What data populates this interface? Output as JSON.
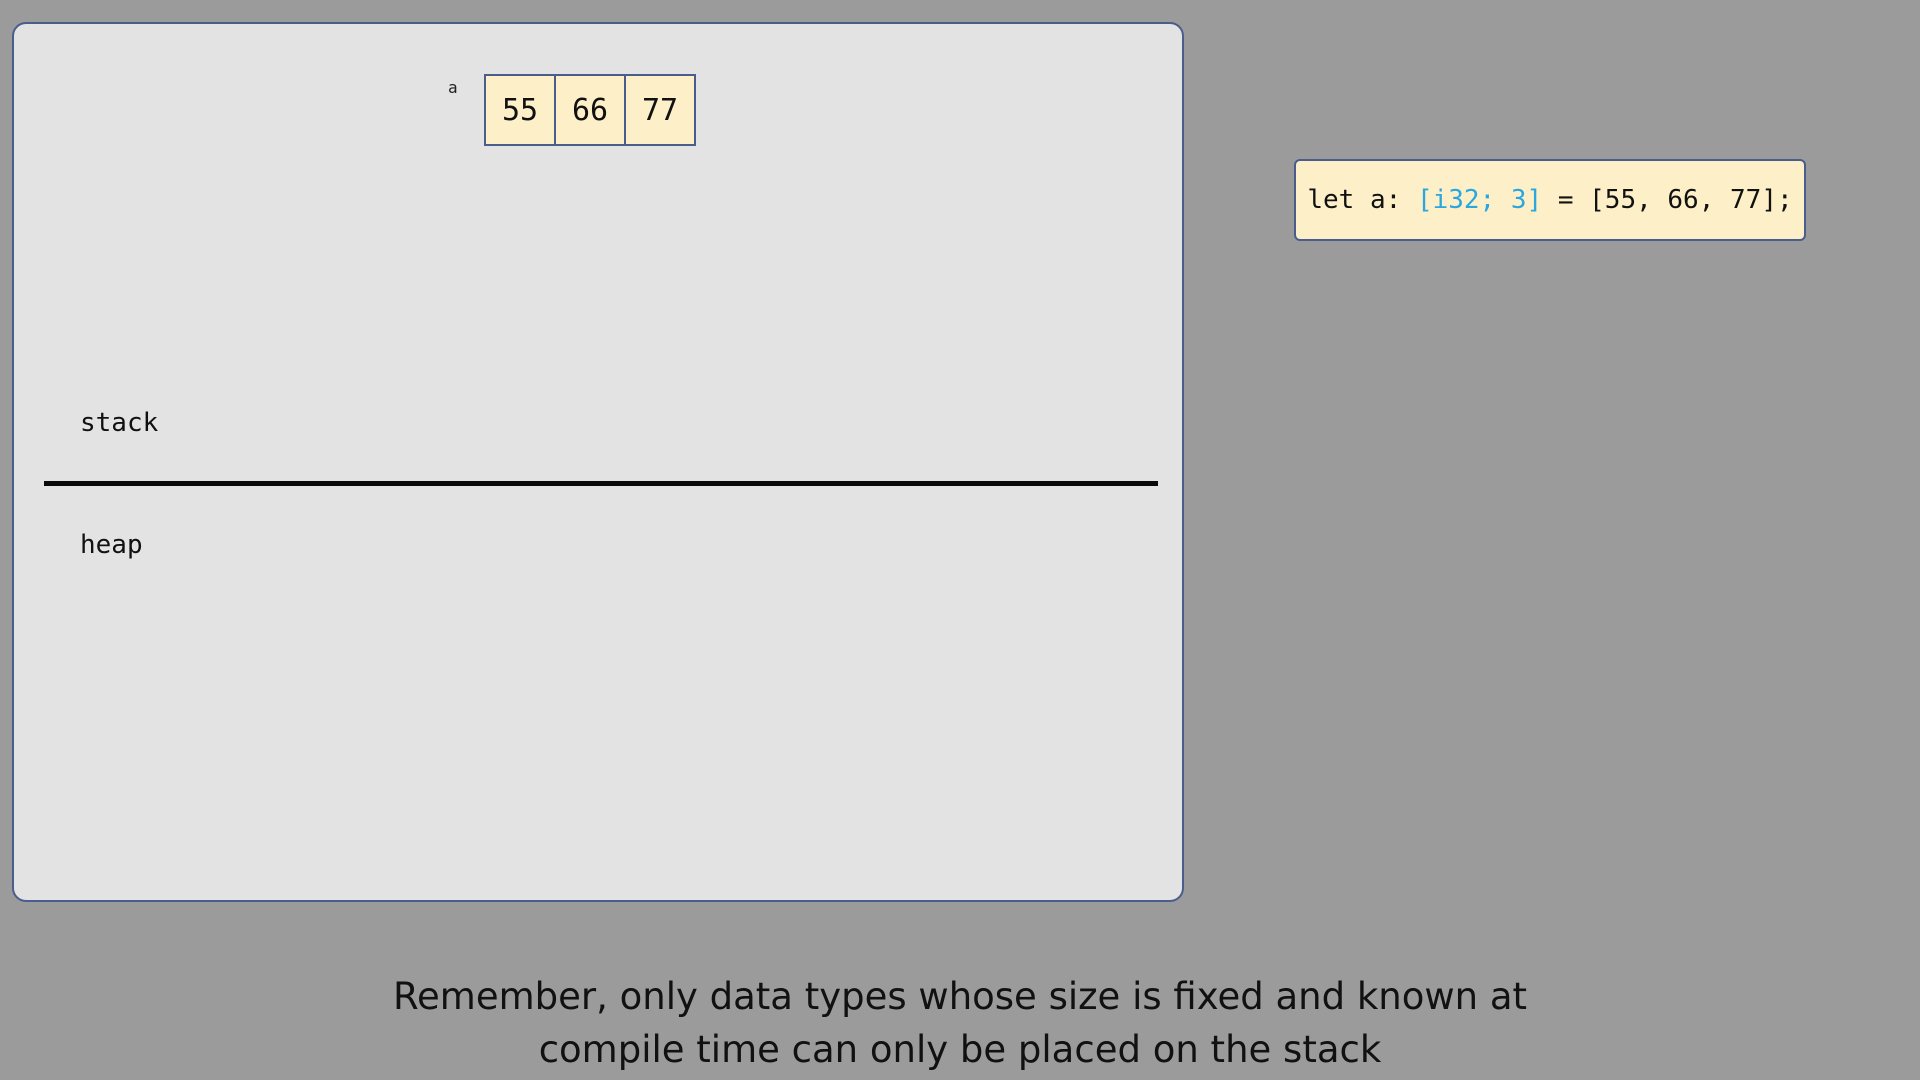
{
  "memory_panel": {
    "variable_name": "a",
    "array_values": [
      "55",
      "66",
      "77"
    ],
    "stack_label": "stack",
    "heap_label": "heap"
  },
  "code": {
    "prefix": "let a: ",
    "type": "[i32; 3]",
    "suffix": " = [55, 66, 77];"
  },
  "caption": {
    "line1": "Remember, only data types whose size is fixed and known at",
    "line2": "compile time can only be placed on the stack"
  },
  "colors": {
    "background": "#9b9b9b",
    "panel": "#e3e3e3",
    "cell_fill": "#fdf0c8",
    "border": "#4a5d8c",
    "type_highlight": "#2aa7e0"
  }
}
